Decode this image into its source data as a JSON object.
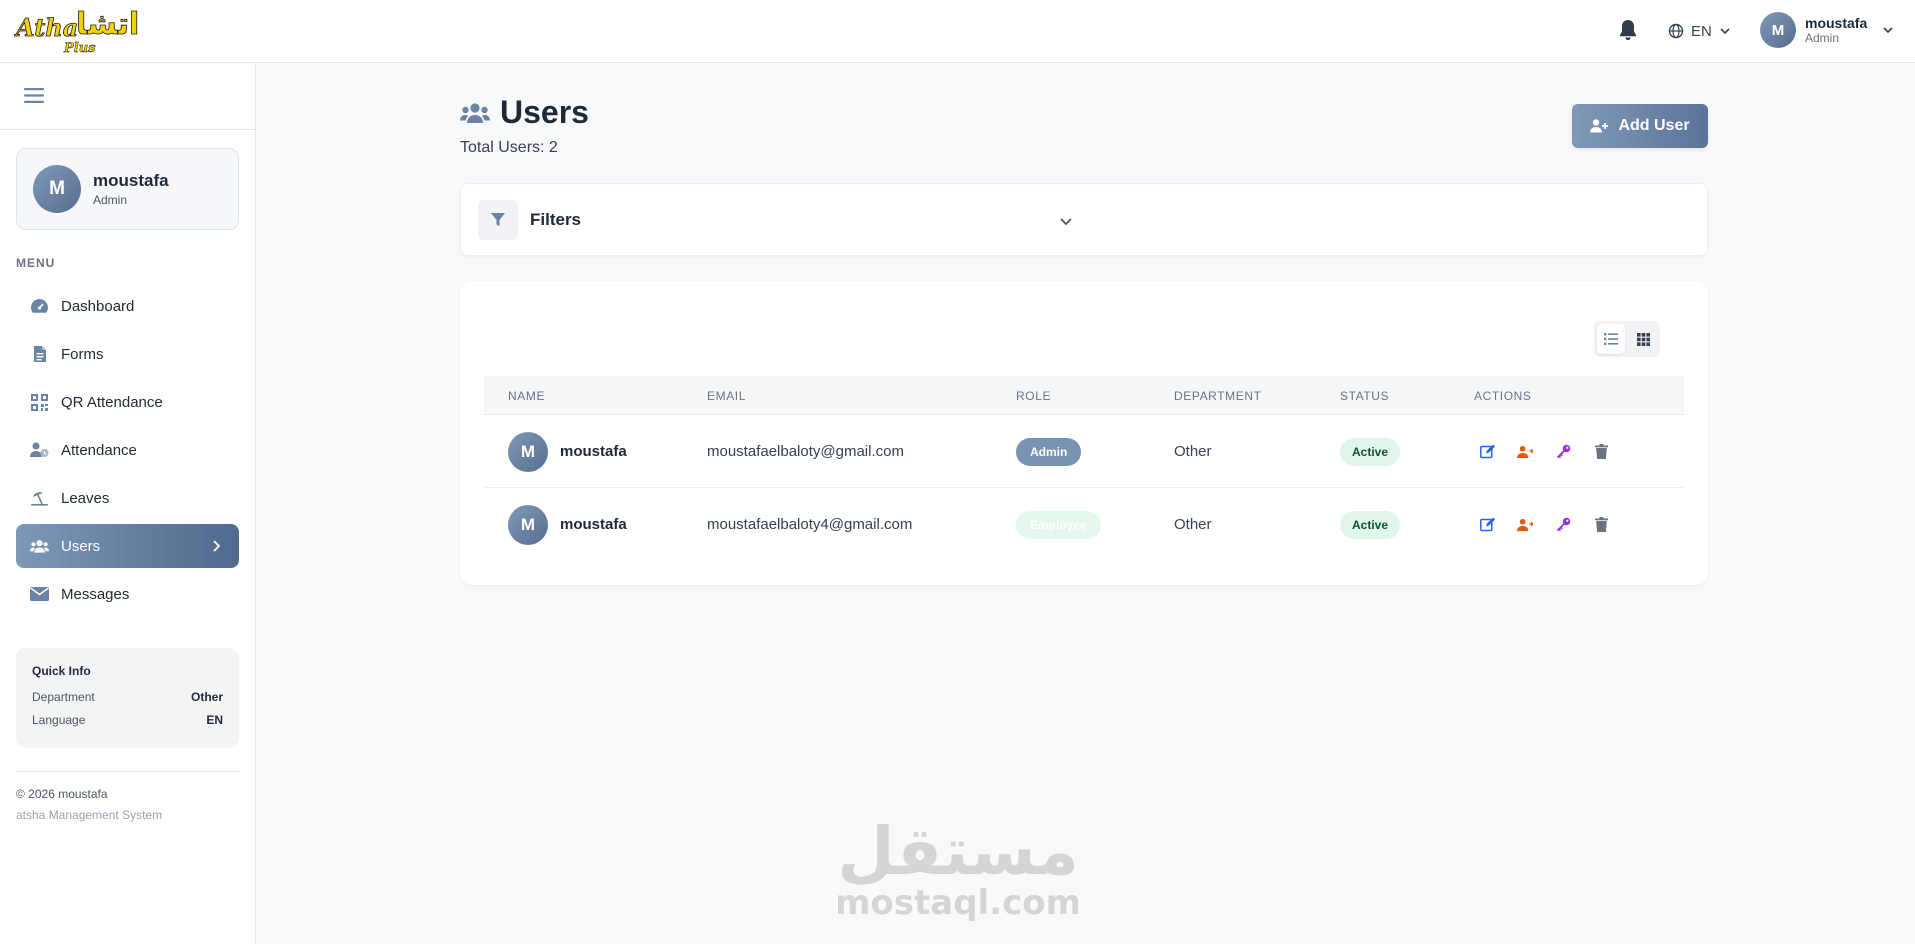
{
  "app": {
    "logo_text": "Athsha Plus"
  },
  "topbar": {
    "language": "EN",
    "user_name": "moustafa",
    "user_role": "Admin",
    "avatar_initial": "M"
  },
  "sidebar": {
    "profile": {
      "initial": "M",
      "name": "moustafa",
      "role": "Admin"
    },
    "menu_heading": "MENU",
    "items": [
      {
        "label": "Dashboard",
        "icon": "gauge-icon"
      },
      {
        "label": "Forms",
        "icon": "document-icon"
      },
      {
        "label": "QR Attendance",
        "icon": "qr-code-icon"
      },
      {
        "label": "Attendance",
        "icon": "user-clock-icon"
      },
      {
        "label": "Leaves",
        "icon": "umbrella-beach-icon"
      },
      {
        "label": "Users",
        "icon": "users-icon",
        "active": true
      },
      {
        "label": "Messages",
        "icon": "envelope-icon"
      }
    ],
    "quick_info": {
      "title": "Quick Info",
      "department_label": "Department",
      "department_value": "Other",
      "language_label": "Language",
      "language_value": "EN"
    },
    "copyright": "© 2026 moustafa",
    "system_name": "atsha Management System"
  },
  "main": {
    "title": "Users",
    "total": "Total Users: 2",
    "add_button": "Add User",
    "filters_label": "Filters",
    "table": {
      "headers": [
        "NAME",
        "EMAIL",
        "ROLE",
        "DEPARTMENT",
        "STATUS",
        "ACTIONS"
      ],
      "rows": [
        {
          "initial": "M",
          "name": "moustafa",
          "email": "moustafaelbaloty@gmail.com",
          "role": "Admin",
          "department": "Other",
          "status": "Active"
        },
        {
          "initial": "M",
          "name": "moustafa",
          "email": "moustafaelbaloty4@gmail.com",
          "role": "Employee",
          "department": "Other",
          "status": "Active"
        }
      ]
    }
  },
  "watermark": {
    "arabic": "مستقل",
    "latin": "mostaql.com"
  },
  "colors": {
    "accent": "#6b84a6",
    "active_badge_bg": "#dff6e8",
    "edit": "#2563eb",
    "role": "#ea580c",
    "key": "#9333ea",
    "delete": "#6b7280"
  }
}
